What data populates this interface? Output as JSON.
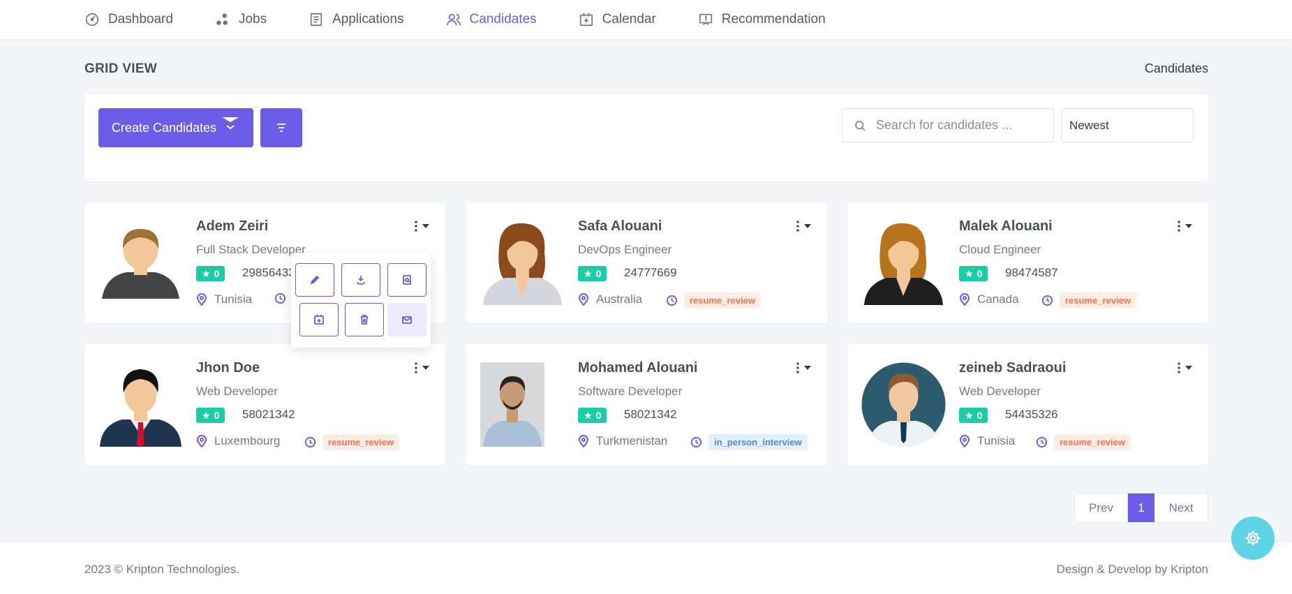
{
  "nav": {
    "items": [
      {
        "label": "Dashboard",
        "icon": "dashboard-icon"
      },
      {
        "label": "Jobs",
        "icon": "jobs-icon"
      },
      {
        "label": "Applications",
        "icon": "applications-icon"
      },
      {
        "label": "Candidates",
        "icon": "candidates-icon",
        "active": true
      },
      {
        "label": "Calendar",
        "icon": "calendar-icon"
      },
      {
        "label": "Recommendation",
        "icon": "recommendation-icon"
      }
    ]
  },
  "page": {
    "title": "GRID VIEW",
    "breadcrumb": "Candidates"
  },
  "toolbar": {
    "create_label": "Create Candidates",
    "search_placeholder": "Search for candidates ...",
    "sort_value": "Newest"
  },
  "candidates": [
    {
      "name": "Adem Zeiri",
      "role": "Full Stack Developer",
      "rating": "0",
      "phone": "29856433",
      "country": "Tunisia",
      "status": ""
    },
    {
      "name": "Safa Alouani",
      "role": "DevOps Engineer",
      "rating": "0",
      "phone": "24777669",
      "country": "Australia",
      "status": "resume_review"
    },
    {
      "name": "Malek Alouani",
      "role": "Cloud Engineer",
      "rating": "0",
      "phone": "98474587",
      "country": "Canada",
      "status": "resume_review"
    },
    {
      "name": "Jhon Doe",
      "role": "Web Developer",
      "rating": "0",
      "phone": "58021342",
      "country": "Luxembourg",
      "status": "resume_review"
    },
    {
      "name": "Mohamed Alouani",
      "role": "Software Developer",
      "rating": "0",
      "phone": "58021342",
      "country": "Turkmenistan",
      "status": "in_person_interview"
    },
    {
      "name": "zeineb Sadraoui",
      "role": "Web Developer",
      "rating": "0",
      "phone": "54435326",
      "country": "Tunisia",
      "status": "resume_review"
    }
  ],
  "action_menu": {
    "icons": [
      "edit-icon",
      "download-icon",
      "view-resume-icon",
      "schedule-icon",
      "delete-icon",
      "email-icon"
    ]
  },
  "pagination": {
    "prev_label": "Prev",
    "current_page": "1",
    "next_label": "Next"
  },
  "footer": {
    "copyright": "2023 © Kripton Technologies.",
    "credit": "Design & Develop by Kripton"
  },
  "colors": {
    "accent": "#6c5ce7",
    "rating": "#1ecba7",
    "status_orange": "#f1734f",
    "status_blue": "#4a8ae6",
    "fab": "#5fd3e6"
  }
}
